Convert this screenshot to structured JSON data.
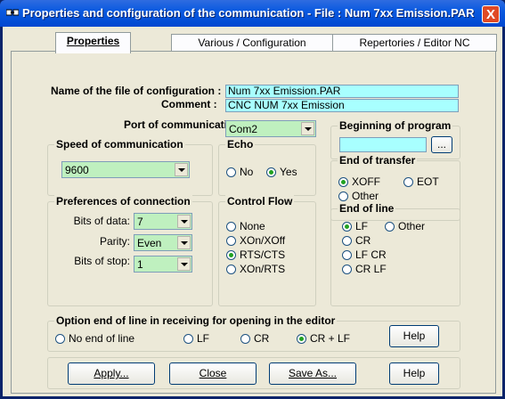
{
  "window": {
    "title": "Properties and configuration of the communication - File : Num 7xx Emission.PAR",
    "close_glyph": "X"
  },
  "tabs": [
    {
      "label": "Properties",
      "active": true
    },
    {
      "label": "Various / Configuration",
      "active": false
    },
    {
      "label": "Repertories / Editor NC",
      "active": false
    }
  ],
  "file": {
    "name_label": "Name of the file of configuration :",
    "name_value": "Num 7xx Emission.PAR",
    "comment_label": "Comment :",
    "comment_value": "CNC NUM 7xx Emission"
  },
  "port": {
    "label": "Port of communication :",
    "value": "Com2"
  },
  "beginning": {
    "title": "Beginning of program",
    "value": "",
    "browse_label": "..."
  },
  "speed": {
    "title": "Speed of communication",
    "value": "9600"
  },
  "echo": {
    "title": "Echo",
    "options": [
      "No",
      "Yes"
    ],
    "selected": "Yes"
  },
  "end_transfer": {
    "title": "End of transfer",
    "options": [
      "XOFF",
      "EOT",
      "Other"
    ],
    "selected": "XOFF"
  },
  "prefs": {
    "title": "Preferences of connection",
    "data_bits_label": "Bits of data:",
    "data_bits_value": "7",
    "parity_label": "Parity:",
    "parity_value": "Even",
    "stop_bits_label": "Bits of stop:",
    "stop_bits_value": "1"
  },
  "flow": {
    "title": "Control Flow",
    "options": [
      "None",
      "XOn/XOff",
      "RTS/CTS",
      "XOn/RTS"
    ],
    "selected": "RTS/CTS"
  },
  "eol": {
    "title": "End of line",
    "options": [
      "LF",
      "Other",
      "CR",
      "LF CR",
      "CR LF"
    ],
    "selected": "LF"
  },
  "option_eol": {
    "title": "Option end of line in receiving for opening in the editor",
    "options": [
      "No end of line",
      "LF",
      "CR",
      "CR + LF"
    ],
    "selected": "CR + LF",
    "help_label": "Help"
  },
  "buttons": {
    "apply": "Apply...",
    "close": "Close",
    "save_as": "Save As...",
    "help": "Help"
  },
  "colors": {
    "titlebar": "#0a5ae0",
    "field_cyan": "#a8ffff",
    "field_green": "#bff0bf",
    "dialog_bg": "#ece9d8"
  }
}
